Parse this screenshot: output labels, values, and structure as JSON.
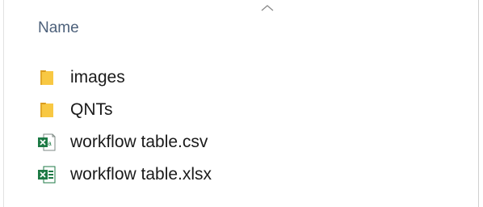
{
  "window": {
    "sort_indicator_icon": "chevron-up-icon"
  },
  "header": {
    "column_name_label": "Name"
  },
  "files": [
    {
      "name": "images",
      "type": "folder",
      "icon": "folder-icon"
    },
    {
      "name": "QNTs",
      "type": "folder",
      "icon": "folder-icon"
    },
    {
      "name": "workflow table.csv",
      "type": "csv",
      "icon": "excel-csv-file-icon"
    },
    {
      "name": "workflow table.xlsx",
      "type": "xlsx",
      "icon": "excel-xlsx-file-icon"
    }
  ],
  "colors": {
    "folder": "#f8c843",
    "folder_dark": "#e3a92a",
    "excel_green": "#1d7a45",
    "header_text": "#4c607a"
  }
}
